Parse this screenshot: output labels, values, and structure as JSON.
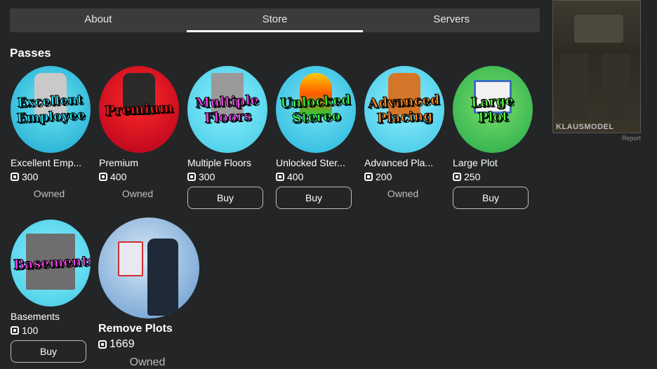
{
  "tabs": [
    {
      "label": "About",
      "active": false
    },
    {
      "label": "Store",
      "active": true
    },
    {
      "label": "Servers",
      "active": false
    }
  ],
  "section_title": "Passes",
  "side_ad": {
    "watermark": "KLAUSMODEL",
    "report_label": "Report"
  },
  "passes": [
    {
      "name": "Excellent Emp...",
      "image_text": "Excellent Employee",
      "price": "300",
      "status": "Owned",
      "button": "",
      "text_color": "#22e8ff",
      "bg": "#27b8d8"
    },
    {
      "name": "Premium",
      "image_text": "Premium",
      "price": "400",
      "status": "Owned",
      "button": "",
      "text_color": "#ff1a1a",
      "bg": "#c8102e"
    },
    {
      "name": "Multiple Floors",
      "image_text": "Multiple Floors",
      "price": "300",
      "status": "",
      "button": "Buy",
      "text_color": "#ff3cf2",
      "bg": "#5fd7ea"
    },
    {
      "name": "Unlocked Ster...",
      "image_text": "Unlocked Stereo",
      "price": "400",
      "status": "",
      "button": "Buy",
      "text_color": "#38ff3a",
      "bg": "#35c7e6"
    },
    {
      "name": "Advanced Pla...",
      "image_text": "Advanced Placing",
      "price": "200",
      "status": "Owned",
      "button": "",
      "text_color": "#ff8a1a",
      "bg": "#4cc9e6"
    },
    {
      "name": "Large Plot",
      "image_text": "Large Plot",
      "price": "250",
      "status": "",
      "button": "Buy",
      "text_color": "#55ff3a",
      "bg": "#2fb84a"
    },
    {
      "name": "Basements",
      "image_text": "Basements",
      "price": "100",
      "status": "",
      "button": "Buy",
      "text_color": "#ff3cf2",
      "bg": "#5fd7ea"
    },
    {
      "name": "Remove Plots",
      "image_text": "",
      "price": "1669",
      "status": "Owned",
      "button": "",
      "text_color": "#ffffff",
      "bg": "#6ea6d8"
    }
  ]
}
